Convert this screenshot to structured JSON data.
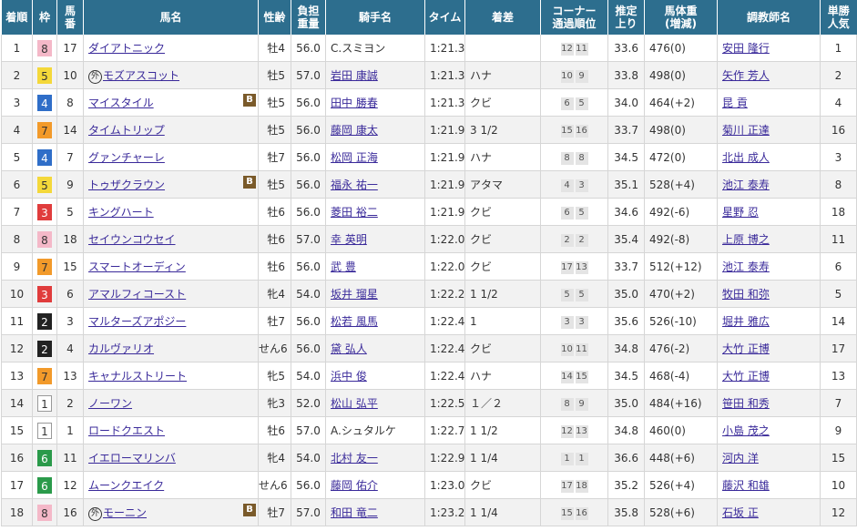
{
  "headers": [
    "着順",
    "枠",
    "馬番",
    "馬名",
    "性齢",
    "負担重量",
    "騎手名",
    "タイム",
    "着差",
    "コーナー通過順位",
    "推定上り",
    "馬体重(増減)",
    "調教師名",
    "単勝人気"
  ],
  "header_lines": [
    [
      "着順"
    ],
    [
      "枠"
    ],
    [
      "馬",
      "番"
    ],
    [
      "馬名"
    ],
    [
      "性齢"
    ],
    [
      "負担",
      "重量"
    ],
    [
      "騎手名"
    ],
    [
      "タイム"
    ],
    [
      "着差"
    ],
    [
      "コーナー",
      "通過順位"
    ],
    [
      "推定",
      "上り"
    ],
    [
      "馬体重",
      "(増減)"
    ],
    [
      "調教師名"
    ],
    [
      "単勝",
      "人気"
    ]
  ],
  "waku_colors": {
    "1": {
      "bg": "#ffffff",
      "fg": "#333333",
      "border": "#999999"
    },
    "2": {
      "bg": "#222222",
      "fg": "#ffffff",
      "border": "#222222"
    },
    "3": {
      "bg": "#e03c3c",
      "fg": "#ffffff",
      "border": "#e03c3c"
    },
    "4": {
      "bg": "#2f6ec8",
      "fg": "#ffffff",
      "border": "#2f6ec8"
    },
    "5": {
      "bg": "#f4d83a",
      "fg": "#333333",
      "border": "#f4d83a"
    },
    "6": {
      "bg": "#2a9a4a",
      "fg": "#ffffff",
      "border": "#2a9a4a"
    },
    "7": {
      "bg": "#f29a2a",
      "fg": "#333333",
      "border": "#f29a2a"
    },
    "8": {
      "bg": "#f4b8c8",
      "fg": "#333333",
      "border": "#f4b8c8"
    }
  },
  "rows": [
    {
      "rank": "1",
      "waku": "8",
      "num": "17",
      "gai": false,
      "horse": "ダイアトニック",
      "blinker": false,
      "sex": "牡4",
      "weight": "56.0",
      "jockey": "C.スミヨン",
      "jockey_link": false,
      "time": "1:21.3",
      "margin": "",
      "pass": [
        "12",
        "11"
      ],
      "last3f": "33.6",
      "body": "476(0)",
      "trainer": "安田 隆行",
      "pop": "1"
    },
    {
      "rank": "2",
      "waku": "5",
      "num": "10",
      "gai": true,
      "horse": "モズアスコット",
      "blinker": false,
      "sex": "牡5",
      "weight": "57.0",
      "jockey": "岩田 康誠",
      "jockey_link": true,
      "time": "1:21.3",
      "margin": "ハナ",
      "pass": [
        "10",
        "9"
      ],
      "last3f": "33.8",
      "body": "498(0)",
      "trainer": "矢作 芳人",
      "pop": "2"
    },
    {
      "rank": "3",
      "waku": "4",
      "num": "8",
      "gai": false,
      "horse": "マイスタイル",
      "blinker": true,
      "sex": "牡5",
      "weight": "56.0",
      "jockey": "田中 勝春",
      "jockey_link": true,
      "time": "1:21.3",
      "margin": "クビ",
      "pass": [
        "6",
        "5"
      ],
      "last3f": "34.0",
      "body": "464(+2)",
      "trainer": "昆 貢",
      "pop": "4"
    },
    {
      "rank": "4",
      "waku": "7",
      "num": "14",
      "gai": false,
      "horse": "タイムトリップ",
      "blinker": false,
      "sex": "牡5",
      "weight": "56.0",
      "jockey": "藤岡 康太",
      "jockey_link": true,
      "time": "1:21.9",
      "margin": "3 1/2",
      "pass": [
        "15",
        "16"
      ],
      "last3f": "33.7",
      "body": "498(0)",
      "trainer": "菊川 正達",
      "pop": "16"
    },
    {
      "rank": "5",
      "waku": "4",
      "num": "7",
      "gai": false,
      "horse": "グァンチャーレ",
      "blinker": false,
      "sex": "牡7",
      "weight": "56.0",
      "jockey": "松岡 正海",
      "jockey_link": true,
      "time": "1:21.9",
      "margin": "ハナ",
      "pass": [
        "8",
        "8"
      ],
      "last3f": "34.5",
      "body": "472(0)",
      "trainer": "北出 成人",
      "pop": "3"
    },
    {
      "rank": "6",
      "waku": "5",
      "num": "9",
      "gai": false,
      "horse": "トゥザクラウン",
      "blinker": true,
      "sex": "牡5",
      "weight": "56.0",
      "jockey": "福永 祐一",
      "jockey_link": true,
      "time": "1:21.9",
      "margin": "アタマ",
      "pass": [
        "4",
        "3"
      ],
      "last3f": "35.1",
      "body": "528(+4)",
      "trainer": "池江 泰寿",
      "pop": "8"
    },
    {
      "rank": "7",
      "waku": "3",
      "num": "5",
      "gai": false,
      "horse": "キングハート",
      "blinker": false,
      "sex": "牡6",
      "weight": "56.0",
      "jockey": "菱田 裕二",
      "jockey_link": true,
      "time": "1:21.9",
      "margin": "クビ",
      "pass": [
        "6",
        "5"
      ],
      "last3f": "34.6",
      "body": "492(-6)",
      "trainer": "星野 忍",
      "pop": "18"
    },
    {
      "rank": "8",
      "waku": "8",
      "num": "18",
      "gai": false,
      "horse": "セイウンコウセイ",
      "blinker": false,
      "sex": "牡6",
      "weight": "57.0",
      "jockey": "幸 英明",
      "jockey_link": true,
      "time": "1:22.0",
      "margin": "クビ",
      "pass": [
        "2",
        "2"
      ],
      "last3f": "35.4",
      "body": "492(-8)",
      "trainer": "上原 博之",
      "pop": "11"
    },
    {
      "rank": "9",
      "waku": "7",
      "num": "15",
      "gai": false,
      "horse": "スマートオーディン",
      "blinker": false,
      "sex": "牡6",
      "weight": "56.0",
      "jockey": "武 豊",
      "jockey_link": true,
      "time": "1:22.0",
      "margin": "クビ",
      "pass": [
        "17",
        "13"
      ],
      "last3f": "33.7",
      "body": "512(+12)",
      "trainer": "池江 泰寿",
      "pop": "6"
    },
    {
      "rank": "10",
      "waku": "3",
      "num": "6",
      "gai": false,
      "horse": "アマルフィコースト",
      "blinker": false,
      "sex": "牝4",
      "weight": "54.0",
      "jockey": "坂井 瑠星",
      "jockey_link": true,
      "time": "1:22.2",
      "margin": "1 1/2",
      "pass": [
        "5",
        "5"
      ],
      "last3f": "35.0",
      "body": "470(+2)",
      "trainer": "牧田 和弥",
      "pop": "5"
    },
    {
      "rank": "11",
      "waku": "2",
      "num": "3",
      "gai": false,
      "horse": "マルターズアポジー",
      "blinker": false,
      "sex": "牡7",
      "weight": "56.0",
      "jockey": "松若 風馬",
      "jockey_link": true,
      "time": "1:22.4",
      "margin": "1",
      "pass": [
        "3",
        "3"
      ],
      "last3f": "35.6",
      "body": "526(-10)",
      "trainer": "堀井 雅広",
      "pop": "14"
    },
    {
      "rank": "12",
      "waku": "2",
      "num": "4",
      "gai": false,
      "horse": "カルヴァリオ",
      "blinker": false,
      "sex": "せん6",
      "weight": "56.0",
      "jockey": "黛 弘人",
      "jockey_link": true,
      "time": "1:22.4",
      "margin": "クビ",
      "pass": [
        "10",
        "11"
      ],
      "last3f": "34.8",
      "body": "476(-2)",
      "trainer": "大竹 正博",
      "pop": "17"
    },
    {
      "rank": "13",
      "waku": "7",
      "num": "13",
      "gai": false,
      "horse": "キャナルストリート",
      "blinker": false,
      "sex": "牝5",
      "weight": "54.0",
      "jockey": "浜中 俊",
      "jockey_link": true,
      "time": "1:22.4",
      "margin": "ハナ",
      "pass": [
        "14",
        "15"
      ],
      "last3f": "34.5",
      "body": "468(-4)",
      "trainer": "大竹 正博",
      "pop": "13"
    },
    {
      "rank": "14",
      "waku": "1",
      "num": "2",
      "gai": false,
      "horse": "ノーワン",
      "blinker": false,
      "sex": "牝3",
      "weight": "52.0",
      "jockey": "松山 弘平",
      "jockey_link": true,
      "time": "1:22.5",
      "margin": "１／２",
      "pass": [
        "8",
        "9"
      ],
      "last3f": "35.0",
      "body": "484(+16)",
      "trainer": "笹田 和秀",
      "pop": "7"
    },
    {
      "rank": "15",
      "waku": "1",
      "num": "1",
      "gai": false,
      "horse": "ロードクエスト",
      "blinker": false,
      "sex": "牡6",
      "weight": "57.0",
      "jockey": "A.シュタルケ",
      "jockey_link": false,
      "time": "1:22.7",
      "margin": "1 1/2",
      "pass": [
        "12",
        "13"
      ],
      "last3f": "34.8",
      "body": "460(0)",
      "trainer": "小島 茂之",
      "pop": "9"
    },
    {
      "rank": "16",
      "waku": "6",
      "num": "11",
      "gai": false,
      "horse": "イエローマリンバ",
      "blinker": false,
      "sex": "牝4",
      "weight": "54.0",
      "jockey": "北村 友一",
      "jockey_link": true,
      "time": "1:22.9",
      "margin": "1 1/4",
      "pass": [
        "1",
        "1"
      ],
      "last3f": "36.6",
      "body": "448(+6)",
      "trainer": "河内 洋",
      "pop": "15"
    },
    {
      "rank": "17",
      "waku": "6",
      "num": "12",
      "gai": false,
      "horse": "ムーンクエイク",
      "blinker": false,
      "sex": "せん6",
      "weight": "56.0",
      "jockey": "藤岡 佑介",
      "jockey_link": true,
      "time": "1:23.0",
      "margin": "クビ",
      "pass": [
        "17",
        "18"
      ],
      "last3f": "35.2",
      "body": "526(+4)",
      "trainer": "藤沢 和雄",
      "pop": "10"
    },
    {
      "rank": "18",
      "waku": "8",
      "num": "16",
      "gai": true,
      "horse": "モーニン",
      "blinker": true,
      "sex": "牡7",
      "weight": "57.0",
      "jockey": "和田 竜二",
      "jockey_link": true,
      "time": "1:23.2",
      "margin": "1 1/4",
      "pass": [
        "15",
        "16"
      ],
      "last3f": "35.8",
      "body": "528(+6)",
      "trainer": "石坂 正",
      "pop": "12"
    }
  ],
  "labels": {
    "gai_mark": "外",
    "blinker_mark": "B"
  }
}
